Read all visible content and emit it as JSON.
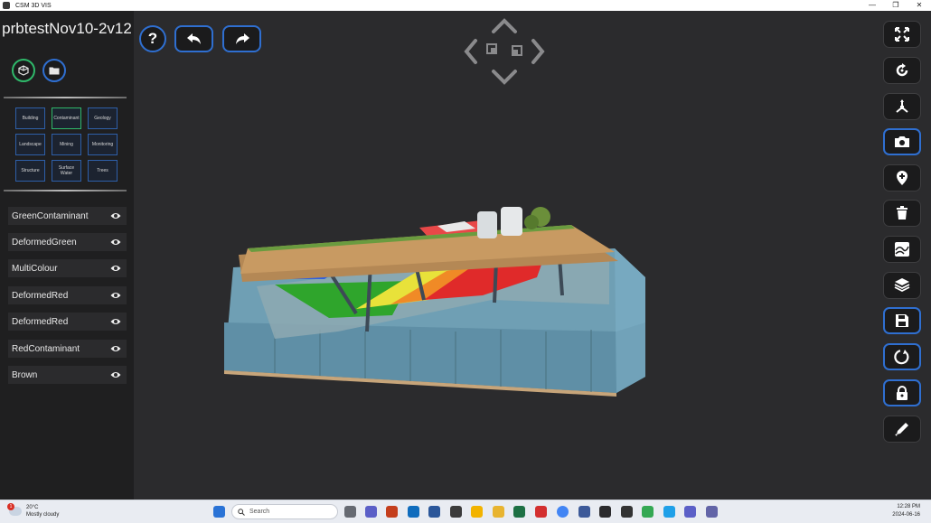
{
  "window": {
    "title": "CSM 3D VIS",
    "controls": [
      "—",
      "❐",
      "✕"
    ]
  },
  "project": {
    "title": "prbtestNov10-2v12"
  },
  "categories": [
    "Building",
    "Contaminant",
    "Geology",
    "Landscape",
    "Mining",
    "Monitoring",
    "Structure",
    "Surface Water",
    "Trees"
  ],
  "active_category": "Contaminant",
  "layers": [
    "GreenContaminant",
    "DeformedGreen",
    "MultiColour",
    "DeformedRed",
    "DeformedRed",
    "RedContaminant",
    "Brown"
  ],
  "toolbar": {
    "help_label": "?"
  },
  "right_tools": [
    "fit-view",
    "rotate",
    "axes",
    "camera",
    "add-marker",
    "delete",
    "map-layer",
    "stack-layers",
    "save",
    "reset",
    "lock",
    "edit"
  ],
  "taskbar": {
    "weather_temp": "20°C",
    "weather_desc": "Mostly cloudy",
    "weather_badge": "1",
    "search_placeholder": "Search",
    "time": "12:28 PM",
    "date": "2024-06-16"
  },
  "colors": {
    "accent_blue": "#2f6fd1",
    "accent_green": "#2fb86a",
    "panel": "#1f1f20",
    "viewport": "#2b2b2d"
  }
}
